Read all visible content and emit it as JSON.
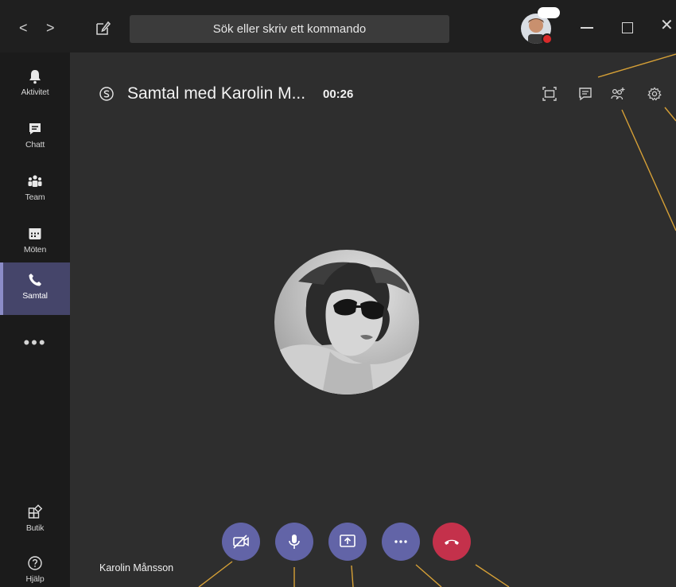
{
  "titlebar": {
    "back_icon": "chevron-left-icon",
    "forward_icon": "chevron-right-icon",
    "back_glyph": "<",
    "forward_glyph": ">",
    "compose_icon": "compose-icon",
    "search_placeholder": "Sök eller skriv ett kommando",
    "status_color": "#d92a2a",
    "close_glyph": "✕"
  },
  "rail": {
    "items": [
      {
        "label": "Aktivitet",
        "icon": "bell-icon"
      },
      {
        "label": "Chatt",
        "icon": "chat-icon"
      },
      {
        "label": "Team",
        "icon": "teams-icon"
      },
      {
        "label": "Möten",
        "icon": "calendar-icon"
      },
      {
        "label": "Samtal",
        "icon": "phone-icon"
      }
    ],
    "active_index": 4,
    "more_label": "•••",
    "bottom": [
      {
        "label": "Butik",
        "icon": "store-icon"
      },
      {
        "label": "Hjälp",
        "icon": "help-icon"
      }
    ]
  },
  "call": {
    "title": "Samtal med Karolin M...",
    "timer": "00:26",
    "caller_name": "Karolin Månsson",
    "top_actions": [
      "fullscreen-icon",
      "chat-icon",
      "add-people-icon",
      "settings-icon"
    ],
    "controls": [
      "video-off-icon",
      "mic-icon",
      "share-screen-icon",
      "more-icon",
      "hang-up-icon"
    ]
  },
  "colors": {
    "accent": "#6264a7",
    "hangup": "#c4314b",
    "callout": "#d6a036",
    "rail_active": "#45456a"
  }
}
